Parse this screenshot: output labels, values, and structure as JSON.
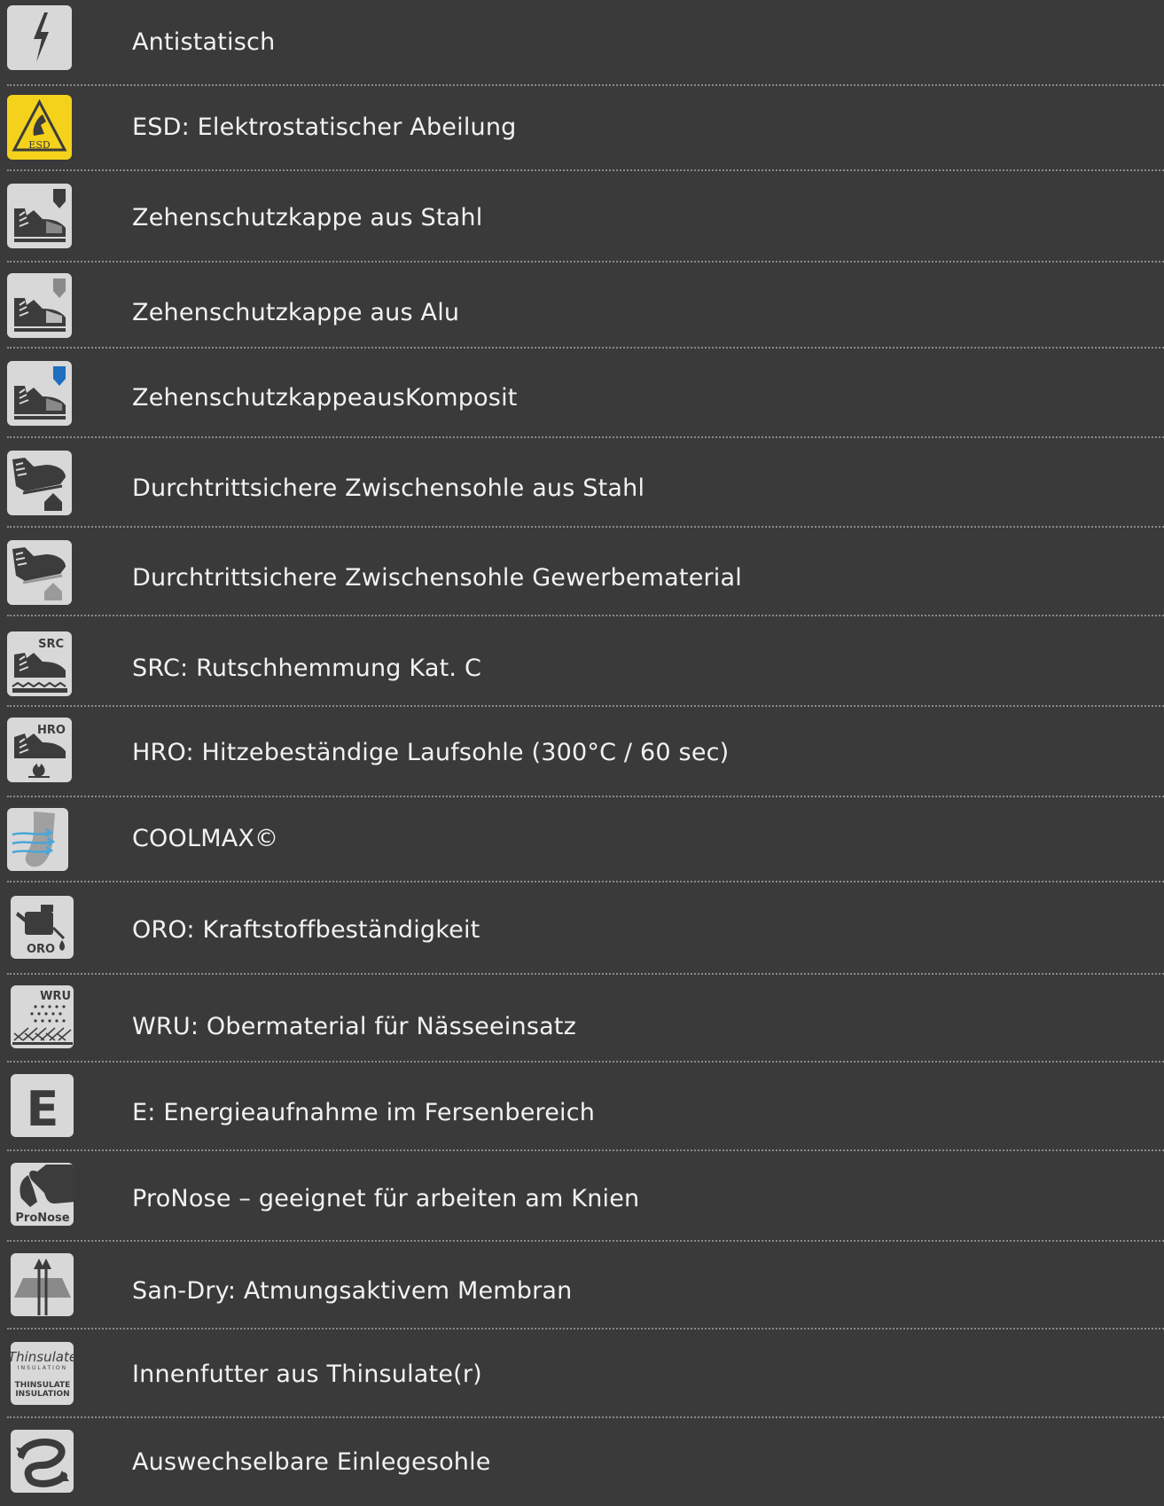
{
  "features": [
    {
      "icon": "lightning-icon",
      "label": "Antistatisch"
    },
    {
      "icon": "esd-icon",
      "label": "ESD: Elektrostatischer Abeilung",
      "icon_text": "ESD"
    },
    {
      "icon": "steel-toecap-icon",
      "label": "Zehenschutzkappe aus Stahl"
    },
    {
      "icon": "alu-toecap-icon",
      "label": "Zehenschutzkappe aus Alu"
    },
    {
      "icon": "composite-toecap-icon",
      "label": "ZehenschutzkappeausKomposit"
    },
    {
      "icon": "steel-midsole-icon",
      "label": "Durchtrittsichere Zwischensohle aus Stahl"
    },
    {
      "icon": "textile-midsole-icon",
      "label": "Durchtrittsichere Zwischensohle Gewerbematerial"
    },
    {
      "icon": "src-icon",
      "label": "SRC: Rutschhemmung Kat. C",
      "icon_text": "SRC"
    },
    {
      "icon": "hro-icon",
      "label": "HRO: Hitzebeständige Laufsohle (300°C / 60 sec)",
      "icon_text": "HRO"
    },
    {
      "icon": "coolmax-icon",
      "label": "COOLMAX©"
    },
    {
      "icon": "oro-icon",
      "label": "ORO: Kraftstoffbeständigkeit",
      "icon_text": "ORO"
    },
    {
      "icon": "wru-icon",
      "label": "WRU: Obermaterial für Nässeeinsatz",
      "icon_text": "WRU"
    },
    {
      "icon": "energy-absorption-icon",
      "label": "E: Energieaufnahme im Fersenbereich",
      "icon_text": "E"
    },
    {
      "icon": "pronose-icon",
      "label": "ProNose – geeignet für arbeiten am Knien",
      "icon_text": "ProNose"
    },
    {
      "icon": "san-dry-icon",
      "label": "San-Dry: Atmungsaktivem Membran"
    },
    {
      "icon": "thinsulate-icon",
      "label": "Innenfutter aus Thinsulate(r)",
      "icon_text": "Thinsulate",
      "icon_text_2": "INSULATION",
      "icon_text_3": "THINSULATE",
      "icon_text_4": "INSULATION"
    },
    {
      "icon": "removable-insole-icon",
      "label": "Auswechselbare Einlegesohle"
    }
  ],
  "colors": {
    "background": "#3a3a3a",
    "icon_bg": "#d8d8d8",
    "icon_dark": "#3c3c3c",
    "esd_yellow": "#f4d21c",
    "composite_blue": "#1e6fc0",
    "coolmax_blue": "#4aa6d8"
  }
}
